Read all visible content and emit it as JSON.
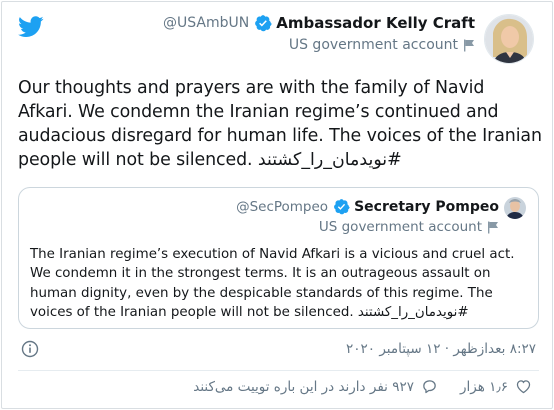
{
  "tweet": {
    "author": {
      "name": "Ambassador Kelly Craft",
      "handle": "@USAmbUN",
      "label": "US government account"
    },
    "text": "Our thoughts and prayers are with the family of Navid Afkari. We condemn the Iranian regime’s continued and audacious disregard for human life. The voices of the Iranian people will not be silenced.",
    "hashtag": "#نویدمان_را_کشتند",
    "timestamp": "۸:۲۷ بعدازظهر · ۱۲ سپتامبر ۲۰۲۰",
    "likes": "۱٫۶ هزار",
    "replies_text": "۹۲۷ نفر دارند در این باره توییت می‌کنند"
  },
  "quoted": {
    "author": {
      "name": "Secretary Pompeo",
      "handle": "@SecPompeo",
      "label": "US government account"
    },
    "text": "The Iranian regime’s execution of Navid Afkari is a vicious and cruel act. We condemn it in the strongest terms. It is an outrageous assault on human dignity, even by the despicable standards of this regime. The voices of the Iranian people will not be silenced.",
    "hashtag": "#نویدمان_را_کشتند"
  },
  "colors": {
    "twitter_blue": "#1da1f2",
    "text": "#14171a",
    "secondary": "#657786",
    "border": "#ccd6dd"
  },
  "icons": [
    "twitter-logo-icon",
    "verified-badge-icon",
    "government-flag-icon",
    "info-icon",
    "heart-icon",
    "reply-bubble-icon"
  ]
}
